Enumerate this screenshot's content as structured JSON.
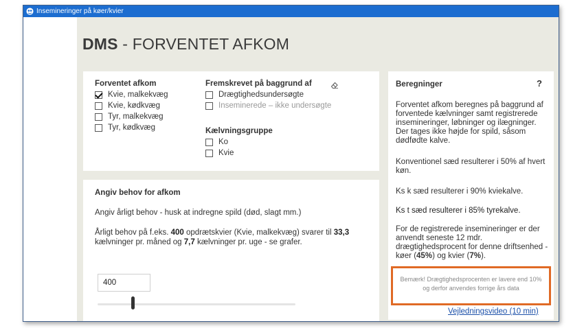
{
  "window": {
    "title": "Insemineringer på køer/kvier"
  },
  "header": {
    "title_bold": "DMS",
    "title_rest": " - FORVENTET AFKOM"
  },
  "filters": {
    "expected": {
      "title": "Forventet afkom",
      "items": [
        {
          "label": "Kvie, malkekvæg",
          "checked": true
        },
        {
          "label": "Kvie, kødkvæg",
          "checked": false
        },
        {
          "label": "Tyr, malkekvæg",
          "checked": false
        },
        {
          "label": "Tyr, kødkvæg",
          "checked": false
        }
      ]
    },
    "projection": {
      "title": "Fremskrevet på baggrund af",
      "items": [
        {
          "label": "Drægtighedsundersøgte",
          "checked": false
        },
        {
          "label": "Inseminerede – ikke undersøgte",
          "checked": false
        }
      ]
    },
    "calving_group": {
      "title": "Kælvningsgruppe",
      "items": [
        {
          "label": "Ko",
          "checked": false
        },
        {
          "label": "Kvie",
          "checked": false
        }
      ]
    }
  },
  "need": {
    "title": "Angiv behov for afkom",
    "text1": "Angiv årligt behov - husk at indregne spild (død, slagt mm.)",
    "text2_a": "Årligt behov på f.eks. ",
    "text2_num1": "400",
    "text2_b": " opdrætskvier (Kvie, malkekvæg) svarer til ",
    "text2_num2": "33,3",
    "text2_c": " kælvninger pr. måned og ",
    "text2_num3": "7,7",
    "text2_d": " kælvninger pr. uge - se grafer.",
    "input_value": "400",
    "slider_level_percent": 17
  },
  "calc": {
    "title": "Beregninger",
    "help": "?",
    "p1": "Forventet afkom beregnes på baggrund af forventede kælvninger samt registrerede insemineringer, løbninger og ilægninger. Der tages ikke højde for spild, såsom dødfødte kalve.",
    "p2": "Konventionel sæd resulterer i 50% af hvert køn.",
    "p3": "Ks k sæd resulterer i 90% kviekalve.",
    "p4": "Ks t sæd resulterer i 85% tyrekalve.",
    "p5_a": "For de registrerede insemineringer er der anvendt seneste 12 mdr. drægtighedsprocent for denne driftsenhed - køer (",
    "p5_cows": "45%",
    "p5_b": ") og kvier (",
    "p5_heifers": "7%",
    "p5_c": ").",
    "notice": "Bemærk! Drægtighedsprocenten er lavere end 10% og derfor anvendes forrige års data",
    "video_link": "Vejledningsvideo (10 min)"
  },
  "colors": {
    "titlebar": "#1c6dd0",
    "notice_border": "#e06a25",
    "link": "#1a4fa8",
    "background": "#eaeae2"
  }
}
